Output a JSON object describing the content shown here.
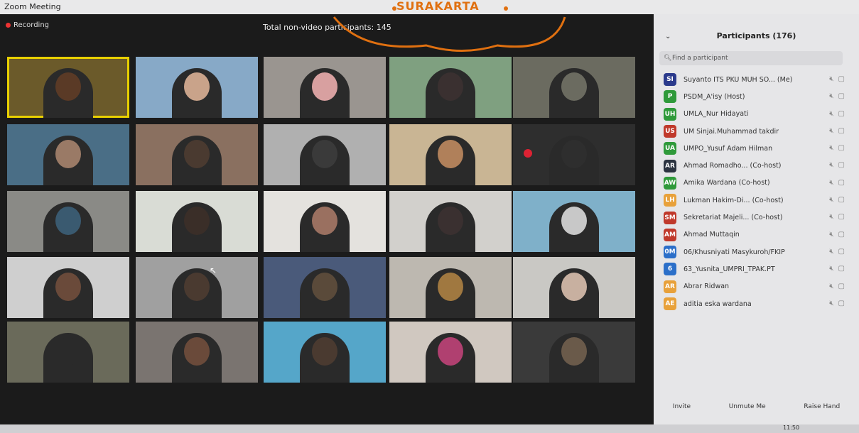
{
  "window": {
    "title": "Zoom Meeting"
  },
  "recording": {
    "label": "Recording"
  },
  "meeting": {
    "non_video_label": "Total non-video participants: 145"
  },
  "watermark": {
    "text": "SURAKARTA",
    "color": "#e07010"
  },
  "participants_panel": {
    "title": "Participants (176)",
    "search_placeholder": "Find a participant",
    "items": [
      {
        "initials": "SI",
        "color": "#2b3a8c",
        "name": "Suyanto ITS PKU MUH SO... (Me)"
      },
      {
        "initials": "P",
        "color": "#2f9a3a",
        "name": "PSDM_A'isy (Host)"
      },
      {
        "initials": "UH",
        "color": "#2f9a3a",
        "name": "UMLA_Nur Hidayati"
      },
      {
        "initials": "US",
        "color": "#c0392b",
        "name": "UM Sinjai.Muhammad takdir"
      },
      {
        "initials": "UA",
        "color": "#2f9a3a",
        "name": "UMPO_Yusuf Adam Hilman"
      },
      {
        "initials": "AR",
        "color": "#2b3340",
        "name": "Ahmad Romadho... (Co-host)"
      },
      {
        "initials": "AW",
        "color": "#2f9a3a",
        "name": "Amika Wardana (Co-host)"
      },
      {
        "initials": "LH",
        "color": "#e8a13a",
        "name": "Lukman Hakim-Di... (Co-host)"
      },
      {
        "initials": "SM",
        "color": "#c0392b",
        "name": "Sekretariat Majeli... (Co-host)"
      },
      {
        "initials": "AM",
        "color": "#c0392b",
        "name": "Ahmad Muttaqin"
      },
      {
        "initials": "0M",
        "color": "#2b6fc9",
        "name": "06/Khusniyati Masykuroh/FKIP"
      },
      {
        "initials": "6",
        "color": "#2b6fc9",
        "name": "63_Yusnita_UMPRI_TPAK.PT"
      },
      {
        "initials": "AR",
        "color": "#e8a13a",
        "name": "Abrar Ridwan"
      },
      {
        "initials": "AE",
        "color": "#e8a13a",
        "name": "aditia eska wardana"
      }
    ],
    "footer": {
      "invite": "Invite",
      "unmute": "Unmute Me",
      "raise_hand": "Raise Hand"
    }
  },
  "taskbar": {
    "clock": "11:50"
  },
  "video_tiles": [
    {
      "bg": "#6b5a2a",
      "skin": "#5a3a26",
      "active": true
    },
    {
      "bg": "#87a9c7",
      "skin": "#c9a38a",
      "active": false
    },
    {
      "bg": "#9a9590",
      "skin": "#d8a0a0",
      "active": false
    },
    {
      "bg": "#7fa080",
      "skin": "#3a3030",
      "active": false
    },
    {
      "bg": "#6b6b60",
      "skin": "#6b6b60",
      "active": false
    },
    {
      "bg": "#4a6e86",
      "skin": "#9a7a66",
      "active": false
    },
    {
      "bg": "#8a7060",
      "skin": "#4a3a30",
      "active": false
    },
    {
      "bg": "#b0b0b0",
      "skin": "#3a3a3a",
      "active": false
    },
    {
      "bg": "#c9b594",
      "skin": "#b0805a",
      "active": false
    },
    {
      "bg": "#2e2e2e",
      "skin": "#2e2e2e",
      "active": false
    },
    {
      "bg": "#8a8a86",
      "skin": "#3a5a70",
      "active": false
    },
    {
      "bg": "#d9dcd5",
      "skin": "#3a2e28",
      "active": false
    },
    {
      "bg": "#e4e2de",
      "skin": "#9a7060",
      "active": false
    },
    {
      "bg": "#d2d0cc",
      "skin": "#3a3030",
      "active": false
    },
    {
      "bg": "#7fb0c9",
      "skin": "#c8c8c8",
      "active": false
    },
    {
      "bg": "#cfcfcf",
      "skin": "#6a4a3a",
      "active": false
    },
    {
      "bg": "#a0a0a0",
      "skin": "#4a3a30",
      "active": false
    },
    {
      "bg": "#4a5a7a",
      "skin": "#5a4a3a",
      "active": false
    },
    {
      "bg": "#bdb8b0",
      "skin": "#a07840",
      "active": false
    },
    {
      "bg": "#c9c8c4",
      "skin": "#c8b0a0",
      "active": false
    },
    {
      "bg": "#6a6a5a",
      "skin": "#2a2a2a",
      "active": false
    },
    {
      "bg": "#7a7470",
      "skin": "#6a4a3a",
      "active": false
    },
    {
      "bg": "#55a6c9",
      "skin": "#4a3a30",
      "active": false
    },
    {
      "bg": "#d0c8c0",
      "skin": "#b04070",
      "active": false
    },
    {
      "bg": "#3a3a3a",
      "skin": "#6a5a4a",
      "active": false
    }
  ]
}
